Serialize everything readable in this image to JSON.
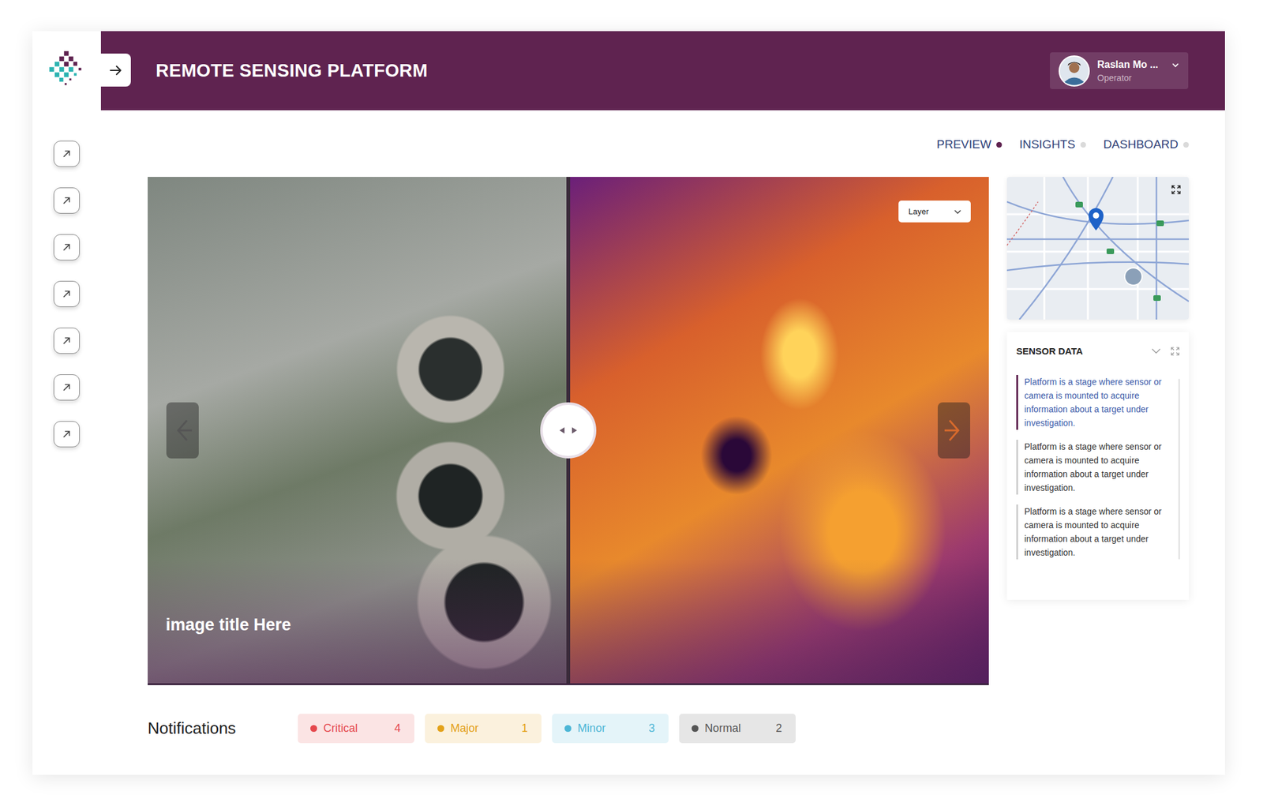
{
  "app": {
    "title": "REMOTE SENSING PLATFORM"
  },
  "sidebar": {
    "items": [
      {
        "selected": false
      },
      {
        "selected": false
      },
      {
        "selected": false
      },
      {
        "selected": false
      },
      {
        "selected": false
      },
      {
        "selected": false
      },
      {
        "selected": false
      }
    ]
  },
  "user": {
    "name": "Raslan Mo ...",
    "role": "Operator"
  },
  "tabs": [
    {
      "label": "PREVIEW",
      "selected": true
    },
    {
      "label": "INSIGHTS",
      "selected": false
    },
    {
      "label": "DASHBOARD",
      "selected": false
    }
  ],
  "viewer": {
    "image_title": "image title Here",
    "layer_select": {
      "label": "Layer"
    },
    "split": 0.5
  },
  "sensor_data": {
    "title": "SENSOR DATA",
    "expanded": true,
    "entries": [
      {
        "text": "Platform is a stage where sensor or camera is mounted to acquire information about a target under investigation.",
        "selected": true
      },
      {
        "text": "Platform is a stage where sensor or camera is mounted to acquire information about a target under investigation.",
        "selected": false
      },
      {
        "text": "Platform is a stage where sensor or camera is mounted to acquire information about a target under investigation.",
        "selected": false
      }
    ]
  },
  "notifications": {
    "title": "Notifications",
    "levels": [
      {
        "label": "Critical",
        "count": "4",
        "color": "#e5484d"
      },
      {
        "label": "Major",
        "count": "1",
        "color": "#e3a21a"
      },
      {
        "label": "Minor",
        "count": "3",
        "color": "#4cb6d6"
      },
      {
        "label": "Normal",
        "count": "2",
        "color": "#555555"
      }
    ]
  }
}
